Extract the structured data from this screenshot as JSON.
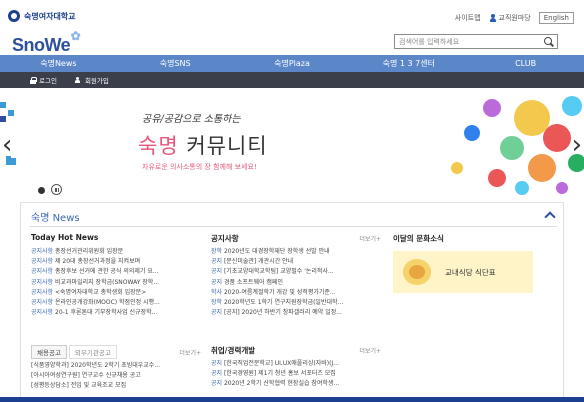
{
  "top": {
    "uni_name": "숙명여자대학교",
    "sitemap": "사이트맵",
    "mypage": "교직원마당",
    "english": "English"
  },
  "brand": {
    "logo": "SnoWe"
  },
  "search": {
    "placeholder": "검색어를 입력하세요"
  },
  "nav": {
    "items": [
      "숙명News",
      "숙명SNS",
      "숙명Plaza",
      "숙명 1 3 7센터",
      "CLUB"
    ]
  },
  "subnav": {
    "login": "로그인",
    "signup": "회원가입"
  },
  "banner": {
    "tagline": "공유/공감으로 소통하는",
    "title_accent": "숙명",
    "title_rest": " 커뮤니티",
    "subtitle": "자유로운 의사소통의 장 함께해 보세요!"
  },
  "news": {
    "header": "숙명 News",
    "hot": {
      "title": "Today Hot News",
      "items": [
        {
          "tag": "공지사항",
          "text": " 총장선거관리위원회 입장문"
        },
        {
          "tag": "공지사항",
          "text": " 제 20대 총장선거과정을 지켜보며"
        },
        {
          "tag": "공지사항",
          "text": " 총장후보 선거에 관한 공식 의의제기 요..."
        },
        {
          "tag": "공지사항",
          "text": " 비교과마일리지 장학금(SNOWAY 장학..."
        },
        {
          "tag": "공지사항",
          "text": " <숙명여자대학교 총학생회 입장문>"
        },
        {
          "tag": "공지사항",
          "text": " 온라인공개강좌(MOOC) 학점인정 시행..."
        },
        {
          "tag": "공지사항",
          "text": " 20-1 후론톤대 기부장학사업 신규장학..."
        }
      ]
    },
    "notice": {
      "title": "공지사항",
      "more": "더보기+",
      "items": [
        {
          "tag": "장학",
          "text": " 2020년도 대경장학재단 장학생 선발 안내"
        },
        {
          "tag": "공지",
          "text": " [문신미술관] 개관시간 안내"
        },
        {
          "tag": "공지",
          "text": " [기초교양대학교학팀] 교양필수 '논리적사..."
        },
        {
          "tag": "공지",
          "text": " 경품 소프트웨어 캠페인"
        },
        {
          "tag": "학사",
          "text": " 2020-여름계절학기 개강 및 성적평가기준..."
        },
        {
          "tag": "장학",
          "text": " 2020학년도 1학기 연구지원장학금(일반대학..."
        },
        {
          "tag": "공지",
          "text": " [공지] 2020년 하반기 창파갤러리 예약 일정..."
        }
      ]
    },
    "culture": {
      "title": "이달의 문화소식",
      "card": "교내식당 식단표"
    },
    "recruit": {
      "tab_active": "채용공고",
      "tab_inactive": "외부기관공고",
      "more": "더보기+",
      "items": [
        "[식품영양학과] 2020학년도 2학기 초빙대우교수...",
        "[아시아여성연구원] 연구교수 신규채용 공고",
        "[성평등상담소] 전임 및 교육조교 모집"
      ]
    },
    "career": {
      "title": "취업/경력개발",
      "more": "더보기+",
      "items": [
        {
          "tag": "공지",
          "text": " [한국직업전문학교] UI,UX애플리싱(자바)(J..."
        },
        {
          "tag": "공지",
          "text": " [한국경영원] 제1기 청년 홍보 서포터즈 모집"
        },
        {
          "tag": "공지",
          "text": " 2020년 2학기 산학협력 현장실습 참여학생..."
        }
      ]
    }
  },
  "colors": {
    "nav": "#5b86c8",
    "subnav": "#3a3f4a",
    "brand": "#1d3f8f",
    "accent": "#e8557a"
  }
}
